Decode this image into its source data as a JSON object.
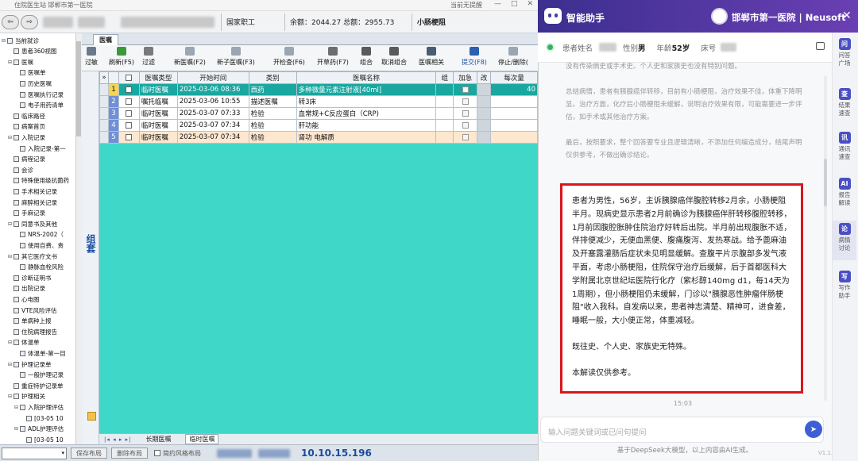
{
  "window": {
    "title": "住院医生站 邯郸市第一医院",
    "center_text": "当前无提醒",
    "controls": [
      "—",
      "□",
      "✕"
    ]
  },
  "patient_bar": {
    "btn1": "⇦",
    "btn2": "⇨",
    "insurance": "国家职工",
    "balance": "余额：2044.27 总额：2955.73",
    "diagnosis": "小肠梗阻"
  },
  "sidebar": {
    "items": [
      {
        "label": "当前就诊",
        "level": 0,
        "exp": "⊟"
      },
      {
        "label": "患者360视图",
        "level": 1,
        "exp": ""
      },
      {
        "label": "医嘱",
        "level": 1,
        "exp": "⊟"
      },
      {
        "label": "医嘱单",
        "level": 2,
        "exp": ""
      },
      {
        "label": "历史医嘱",
        "level": 2,
        "exp": ""
      },
      {
        "label": "医嘱执行记录",
        "level": 2,
        "exp": ""
      },
      {
        "label": "电子用药清单",
        "level": 2,
        "exp": ""
      },
      {
        "label": "临床路径",
        "level": 1,
        "exp": ""
      },
      {
        "label": "病案首页",
        "level": 1,
        "exp": ""
      },
      {
        "label": "入院记录",
        "level": 1,
        "exp": "⊟"
      },
      {
        "label": "入院记录-第一",
        "level": 2,
        "exp": ""
      },
      {
        "label": "病程记录",
        "level": 1,
        "exp": ""
      },
      {
        "label": "会诊",
        "level": 1,
        "exp": ""
      },
      {
        "label": "特殊使用级抗菌药",
        "level": 1,
        "exp": ""
      },
      {
        "label": "手术相关记录",
        "level": 1,
        "exp": ""
      },
      {
        "label": "麻醉相关记录",
        "level": 1,
        "exp": ""
      },
      {
        "label": "手麻记录",
        "level": 1,
        "exp": ""
      },
      {
        "label": "同意书及其他",
        "level": 1,
        "exp": "⊟"
      },
      {
        "label": "NRS-2002（",
        "level": 2,
        "exp": ""
      },
      {
        "label": "使用自费、贵",
        "level": 2,
        "exp": ""
      },
      {
        "label": "其它医疗文书",
        "level": 1,
        "exp": "⊟"
      },
      {
        "label": "静脉血栓风险",
        "level": 2,
        "exp": ""
      },
      {
        "label": "诊断证明书",
        "level": 1,
        "exp": ""
      },
      {
        "label": "出院记录",
        "level": 1,
        "exp": ""
      },
      {
        "label": "心电图",
        "level": 1,
        "exp": ""
      },
      {
        "label": "VTE风险评估",
        "level": 1,
        "exp": ""
      },
      {
        "label": "单病种上报",
        "level": 1,
        "exp": ""
      },
      {
        "label": "住院病理报告",
        "level": 1,
        "exp": ""
      },
      {
        "label": "体温单",
        "level": 1,
        "exp": "⊟"
      },
      {
        "label": "体温单-第一目",
        "level": 2,
        "exp": ""
      },
      {
        "label": "护理记录单",
        "level": 1,
        "exp": "⊟"
      },
      {
        "label": "一般护理记录",
        "level": 2,
        "exp": ""
      },
      {
        "label": "重症特护记录单",
        "level": 1,
        "exp": ""
      },
      {
        "label": "护理相关",
        "level": 1,
        "exp": "⊟"
      },
      {
        "label": "入院护理评估",
        "level": 2,
        "exp": "⊟"
      },
      {
        "label": "[03-05 10",
        "level": 3,
        "exp": ""
      },
      {
        "label": "ADL护理评估",
        "level": 2,
        "exp": "⊟"
      },
      {
        "label": "[03-05 10",
        "level": 3,
        "exp": ""
      }
    ]
  },
  "tabs": {
    "main": "医嘱",
    "vertical": "组套"
  },
  "toolbar": {
    "buttons": [
      "过敏",
      "刷新(F5)",
      "过滤",
      "新医嘱(F2)",
      "新子医嘱(F3)",
      "开检查(F6)",
      "开草药(F7)",
      "组合",
      "取消组合",
      "医嘱相关",
      "提交(F8)",
      "停止/删除("
    ]
  },
  "table": {
    "headers": [
      "",
      "",
      "医嘱类型",
      "开始时间",
      "类别",
      "医嘱名称",
      "组",
      "加急",
      "改",
      "每次量"
    ],
    "rows": [
      {
        "n": "1",
        "type": "临时医嘱",
        "time": "2025-03-06 08:36",
        "cat": "西药",
        "name": "多种微量元素注射液[40ml]",
        "qty": "40",
        "selected": true
      },
      {
        "n": "2",
        "type": "嘱托临嘱",
        "time": "2025-03-06 10:55",
        "cat": "描述医嘱",
        "name": "转3床",
        "qty": "",
        "selected": false
      },
      {
        "n": "3",
        "type": "临时医嘱",
        "time": "2025-03-07 07:33",
        "cat": "检验",
        "name": "血常规+C反应蛋白（CRP)",
        "qty": "",
        "selected": false
      },
      {
        "n": "4",
        "type": "临时医嘱",
        "time": "2025-03-07 07:34",
        "cat": "检验",
        "name": "肝功能",
        "qty": "",
        "selected": false
      },
      {
        "n": "5",
        "type": "临时医嘱",
        "time": "2025-03-07 07:34",
        "cat": "检验",
        "name": "肾功 电解质",
        "qty": "",
        "selected": false
      }
    ]
  },
  "bottom_tabs": {
    "nav": "|◂ ◂ ▸ ▸|",
    "tab1": "长期医嘱",
    "tab2": "临时医嘱"
  },
  "status": {
    "arrow": "▾",
    "save": "保存布局",
    "delete": "删除布局",
    "simple": "简约风格布局",
    "ip": "10.10.15.196"
  },
  "assistant": {
    "title": "智能助手",
    "org": "邯郸市第一医院 | Neusoft",
    "close": "✕",
    "patient_label": "患者姓名",
    "sex_label": "性别",
    "sex": "男",
    "age_label": "年龄",
    "age": "52岁",
    "bed_label": "床号",
    "faded": [
      "没有传染病史或手术史。个人史和家族史也没有特别问题。",
      "总结病情，患者有胰腺癌伴转移，目前有小肠梗阻，治疗效果不佳，体重下降明显。治疗方面，化疗后小肠梗阻未缓解，说明治疗效果有限，可能需要进一步评估，如手术或其他治疗方案。",
      "最后，按照要求，整个回答要专业且逻辑清晰，不添加任何编造成分，结尾声明仅供参考，不做出确诊结论。"
    ],
    "answer": [
      "患者为男性，56岁，主诉胰腺癌伴腹腔转移2月余，小肠梗阻半月。现病史显示患者2月前确诊为胰腺癌伴肝转移腹腔转移，1月前因腹腔胀肿住院治疗好转后出院。半月前出现腹胀不适，伴排便减少，无便血黑便、腹痛腹泻、发热寒战。给予蓖麻油及开塞露灌肠后症状未见明显缓解。查腹平片示腹部多发气液平面，考虑小肠梗阻，住院保守治疗后缓解，后于首都医科大学附属北京世纪坛医院行化疗（紫杉醇140mg d1，每14天为1周期），但小肠梗阻仍未缓解，门诊以\"胰腺恶性肿瘤伴肠梗阻\"收入我科。自发病以来，患者神志清楚、精神可，进食差，睡眠一般，大小便正常，体重减轻。",
      "既往史、个人史、家族史无特殊。",
      "本解读仅供参考。"
    ],
    "time": "15:03",
    "input_placeholder": "输入问题关键词或已问句提问",
    "footer": "基于DeepSeek大模型，以上内容由AI生成。",
    "version": "V1.1.007",
    "rail": [
      {
        "label": "问答广场",
        "icon": "问"
      },
      {
        "label": "结果速查",
        "icon": "查"
      },
      {
        "label": "通讯速查",
        "icon": "讯"
      },
      {
        "label": "报告解读",
        "icon": "AI"
      },
      {
        "label": "病情讨论",
        "icon": "论"
      },
      {
        "label": "写作助手",
        "icon": "写"
      }
    ]
  },
  "colors": {
    "grid_bg": "#3fd7c8",
    "selected_row": "#1aa7a0",
    "highlight": "#d9161d",
    "header": "#4a35a0"
  }
}
